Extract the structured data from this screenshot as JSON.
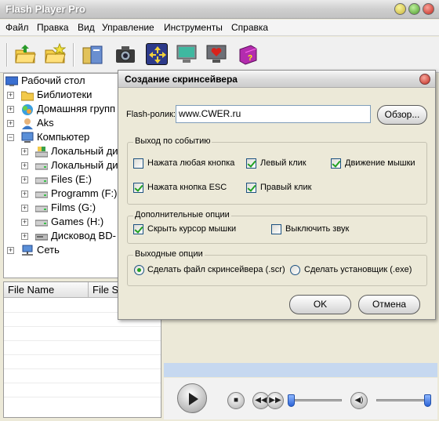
{
  "window": {
    "title": "Flash Player Pro"
  },
  "menu": [
    "Файл",
    "Правка",
    "Вид",
    "Управление",
    "Инструменты",
    "Справка"
  ],
  "toolbar": {
    "buttons": [
      "open-folder-icon",
      "add-folder-icon",
      "library-icon",
      "camera-icon",
      "resize-icon",
      "screensaver-monitor-icon",
      "heart-monitor-icon",
      "help-book-icon"
    ]
  },
  "tree": {
    "items": [
      {
        "label": "Рабочий стол",
        "icon": "desktop-icon"
      },
      {
        "label": "Библиотеки",
        "icon": "folder-icon"
      },
      {
        "label": "Домашняя групп",
        "icon": "homegroup-icon"
      },
      {
        "label": "Aks",
        "icon": "user-icon"
      },
      {
        "label": "Компьютер",
        "icon": "computer-icon"
      },
      {
        "label": "Локальный ди",
        "icon": "system-drive-icon"
      },
      {
        "label": "Локальный ди",
        "icon": "drive-icon"
      },
      {
        "label": "Files (E:)",
        "icon": "drive-icon"
      },
      {
        "label": "Programm (F:)",
        "icon": "drive-icon"
      },
      {
        "label": "Films (G:)",
        "icon": "drive-icon"
      },
      {
        "label": "Games (H:)",
        "icon": "drive-icon"
      },
      {
        "label": "Дисковод BD-",
        "icon": "optical-drive-icon"
      },
      {
        "label": "Сеть",
        "icon": "network-icon"
      }
    ]
  },
  "filelist": {
    "columns": [
      "File Name",
      "File S"
    ]
  },
  "dialog": {
    "title": "Создание скринсейвера",
    "flash_label": "Flash-ролик:",
    "flash_value": "www.CWER.ru",
    "browse": "Обзор...",
    "group_exit": {
      "title": "Выход по событию",
      "options": [
        {
          "label": "Нажата любая кнопка",
          "checked": false
        },
        {
          "label": "Левый клик",
          "checked": true
        },
        {
          "label": "Движение мышки",
          "checked": true
        },
        {
          "label": "Нажата кнопка ESC",
          "checked": true
        },
        {
          "label": "Правый клик",
          "checked": true
        }
      ]
    },
    "group_extra": {
      "title": "Дополнительные опции",
      "options": [
        {
          "label": "Скрыть курсор мышки",
          "checked": true
        },
        {
          "label": "Выключить звук",
          "checked": false
        }
      ]
    },
    "group_output": {
      "title": "Выходные опции",
      "options": [
        {
          "label": "Сделать файл скринсейвера (.scr)",
          "selected": true
        },
        {
          "label": "Сделать установщик (.exe)",
          "selected": false
        }
      ]
    },
    "ok": "OK",
    "cancel": "Отмена"
  },
  "player": {
    "position": 0.0,
    "volume": 0.95
  }
}
